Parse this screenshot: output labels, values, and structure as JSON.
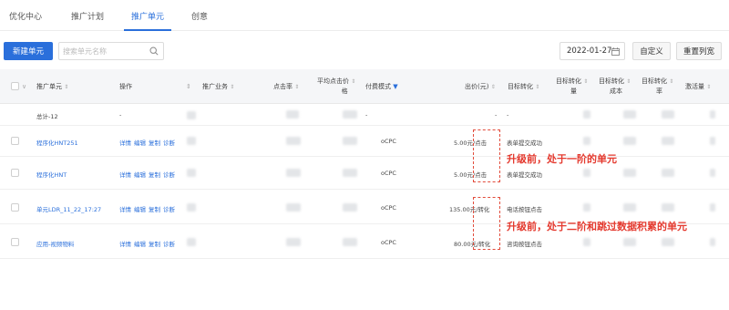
{
  "tabs": [
    {
      "label": "优化中心",
      "active": false
    },
    {
      "label": "推广计划",
      "active": false
    },
    {
      "label": "推广单元",
      "active": true
    },
    {
      "label": "创意",
      "active": false
    }
  ],
  "toolbar": {
    "new_unit": "新建单元",
    "search_placeholder": "搜索单元名称",
    "date": "2022-01-27",
    "customize": "自定义",
    "reset_columns": "重置列宽"
  },
  "table": {
    "headers": {
      "unit": "推广单元",
      "operation": "操作",
      "business": "推广业务",
      "ctr": "点击率",
      "avg_click_price_1": "平均点击价",
      "avg_click_price_2": "格",
      "pay_mode": "付费模式",
      "bid": "出价(元)",
      "goal": "目标转化",
      "goal_cost_1": "目标转化",
      "goal_cost_2": "量",
      "goal_cost3_1": "目标转化",
      "goal_cost3_2": "成本",
      "goal_rate_1": "目标转化",
      "goal_rate_2": "率",
      "activation": "激活量"
    },
    "total_row": {
      "name": "总计-12",
      "op": "-",
      "pay_mode": "-",
      "bid": "-",
      "goal": "-"
    },
    "rows": [
      {
        "name": "程序化HNT251",
        "ops": [
          "详情",
          "编辑",
          "复制",
          "诊断"
        ],
        "pay_mode": "oCPC",
        "bid": "5.00元/点击",
        "goal": "表单提交成功"
      },
      {
        "name": "程序化HNT",
        "ops": [
          "详情",
          "编辑",
          "复制",
          "诊断"
        ],
        "pay_mode": "oCPC",
        "bid": "5.00元/点击",
        "goal": "表单提交成功"
      },
      {
        "name": "单元LDR_11_22_17:27",
        "ops": [
          "详情",
          "编辑",
          "复制",
          "诊断"
        ],
        "pay_mode": "oCPC",
        "bid": "135.00元/转化",
        "goal": "电话按钮点击"
      },
      {
        "name": "应用-视频物料",
        "ops": [
          "详情",
          "编辑",
          "复制",
          "诊断"
        ],
        "pay_mode": "oCPC",
        "bid": "80.00元/转化",
        "goal": "咨询按钮点击"
      }
    ]
  },
  "annotations": {
    "first": "升级前，处于一阶的单元",
    "second": "升级前，处于二阶和跳过数据积累的单元"
  },
  "colors": {
    "accent": "#2a6fdb",
    "annotation": "#e4392e"
  }
}
